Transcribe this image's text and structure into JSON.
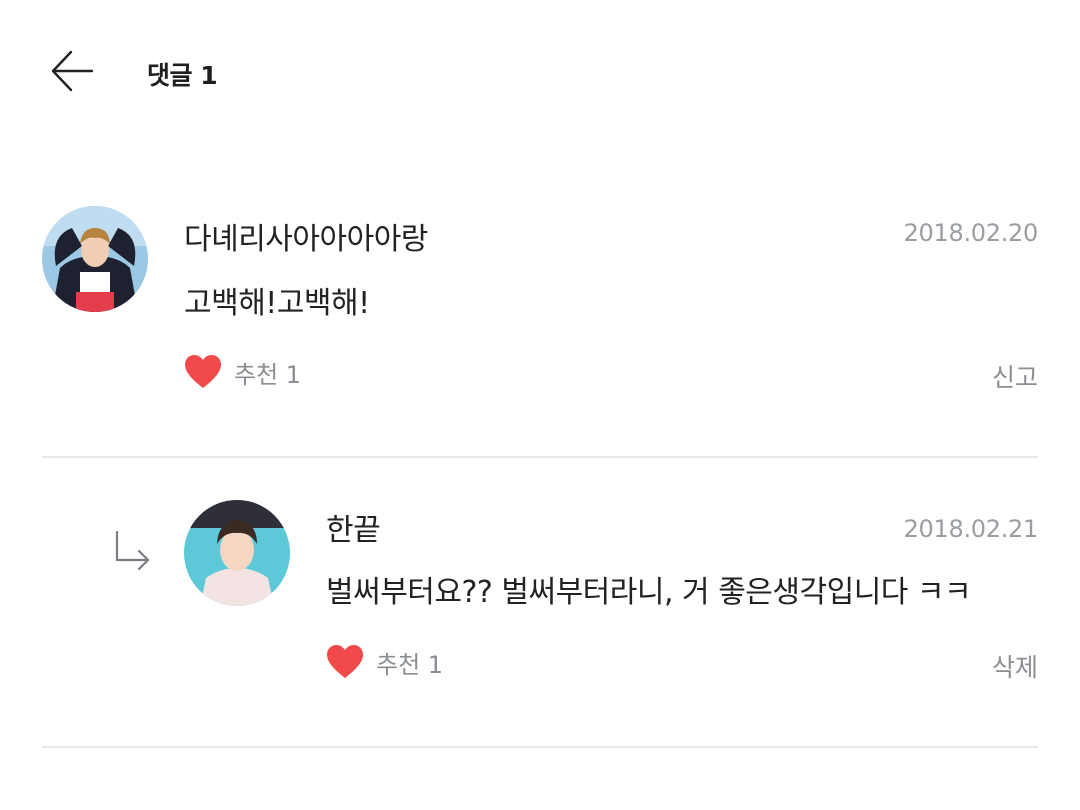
{
  "header": {
    "title": "댓글 1",
    "back_icon": "arrow-left-icon"
  },
  "comments": [
    {
      "author": "다녜리사아아아아랑",
      "date": "2018.02.20",
      "text": "고백해!고백해!",
      "like_label": "추천 1",
      "like_icon": "heart-icon",
      "action_label": "신고"
    },
    {
      "is_reply": true,
      "reply_icon": "reply-arrow-icon",
      "author": "한끝",
      "date": "2018.02.21",
      "text": "벌써부터요?? 벌써부터라니, 거 좋은생각입니다 ㅋㅋ",
      "like_label": "추천 1",
      "like_icon": "heart-icon",
      "action_label": "삭제"
    }
  ],
  "colors": {
    "heart": "#f24a4a",
    "muted_text": "#8a8e93",
    "date_text": "#9a9ea3",
    "divider": "#e6e7e9"
  }
}
